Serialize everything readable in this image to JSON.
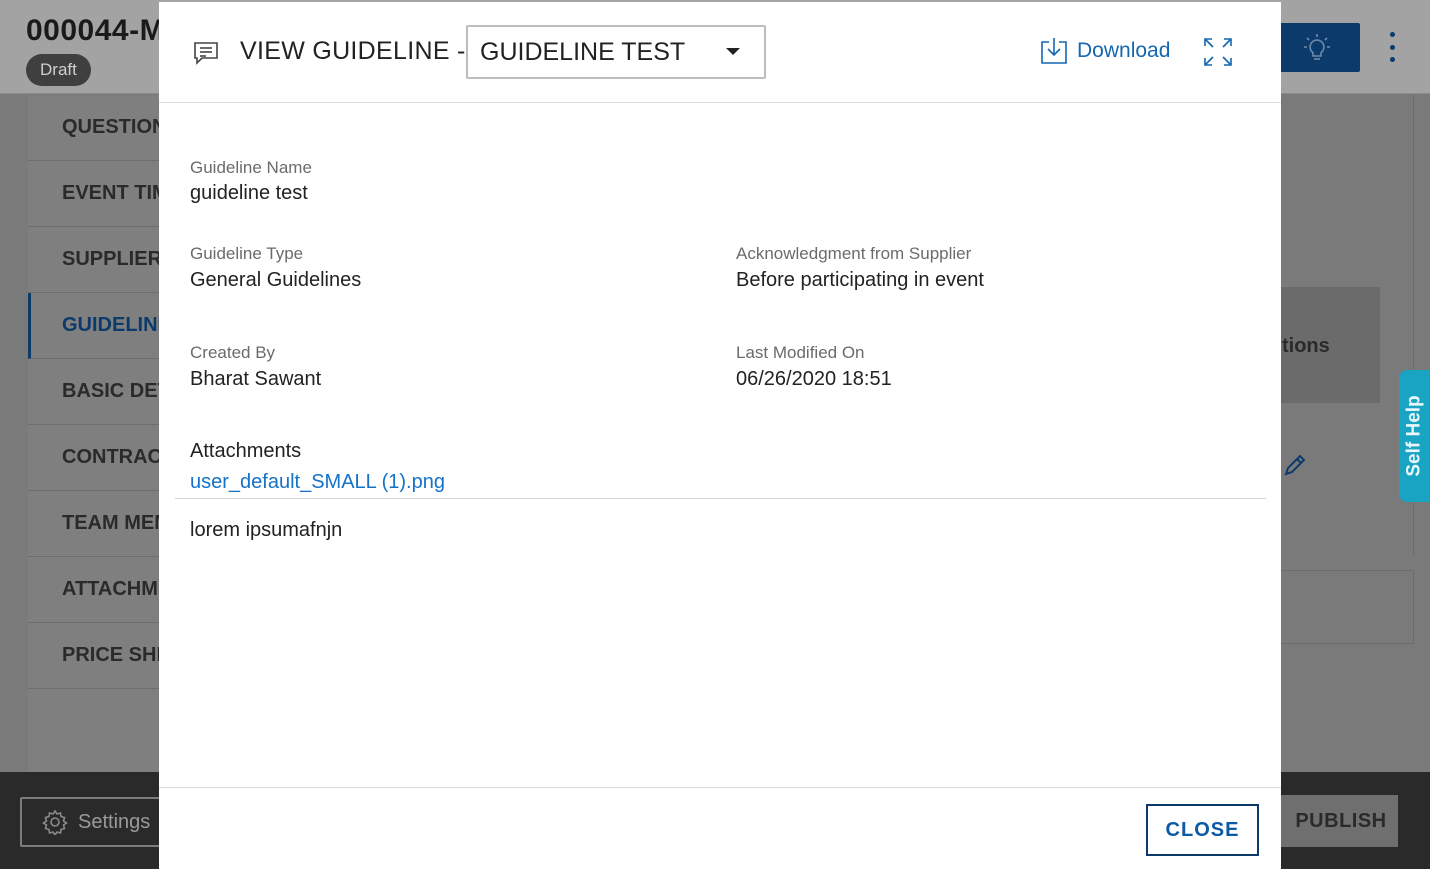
{
  "background": {
    "record_title": "000044-M",
    "status_badge": "Draft",
    "nav_items": [
      {
        "label": "QUESTION"
      },
      {
        "label": "EVENT TIM"
      },
      {
        "label": "SUPPLIERS"
      },
      {
        "label": "GUIDELINE"
      },
      {
        "label": "BASIC DET"
      },
      {
        "label": "CONTRACT"
      },
      {
        "label": "TEAM MEM"
      },
      {
        "label": "ATTACHM"
      },
      {
        "label": "PRICE SHE"
      }
    ],
    "active_nav_index": 3,
    "card_text": "tions",
    "settings_label": "Settings",
    "publish_label": "PUBLISH",
    "self_help_label": "Self Help"
  },
  "modal": {
    "header": {
      "title": "VIEW GUIDELINE -",
      "selected_guideline": "GUIDELINE TEST",
      "download_label": "Download"
    },
    "fields": {
      "guideline_name_label": "Guideline Name",
      "guideline_name_value": "guideline test",
      "guideline_type_label": "Guideline Type",
      "guideline_type_value": "General Guidelines",
      "acknowledgment_label": "Acknowledgment from Supplier",
      "acknowledgment_value": "Before participating in event",
      "created_by_label": "Created By",
      "created_by_value": "Bharat Sawant",
      "last_modified_label": "Last Modified On",
      "last_modified_value": "06/26/2020 18:51"
    },
    "attachments": {
      "title": "Attachments",
      "file_name": "user_default_SMALL (1).png"
    },
    "description": "lorem ipsumafnjn",
    "footer": {
      "close_label": "CLOSE"
    }
  },
  "colors": {
    "primary_dark": "#0c3b6b",
    "link_blue": "#1472c8",
    "self_help_teal": "#1aa4c4",
    "overlay_grey": "#7a7a7a"
  }
}
